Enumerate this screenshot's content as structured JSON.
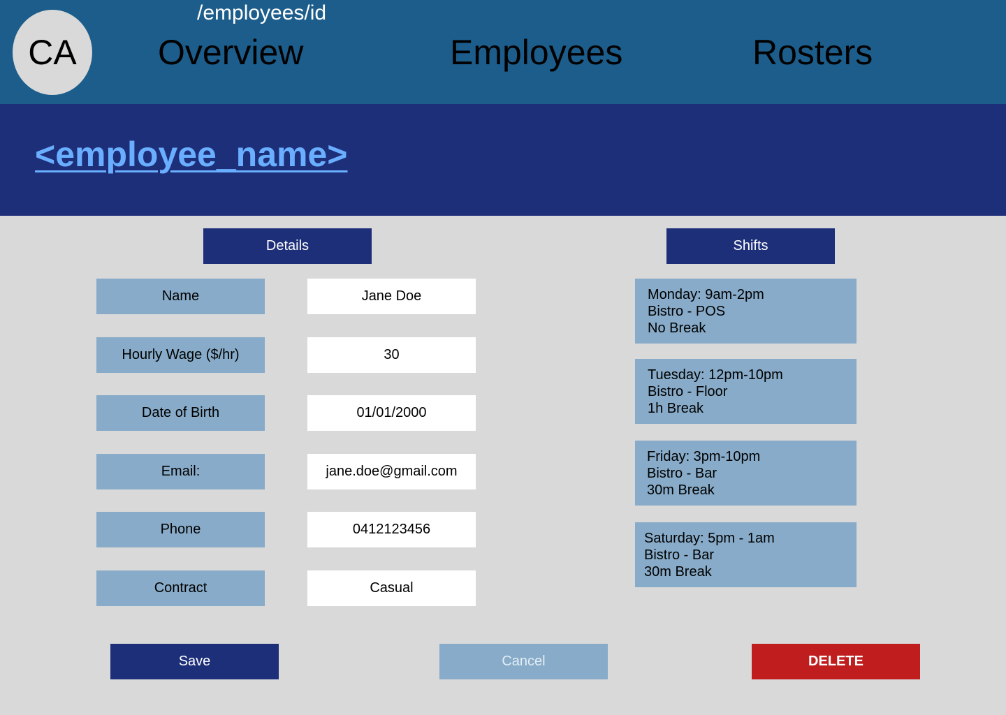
{
  "header": {
    "avatar": "CA",
    "route": "/employees/id",
    "nav": [
      "Overview",
      "Employees",
      "Rosters"
    ]
  },
  "page_title": "<employee_name>",
  "sections": {
    "details": "Details",
    "shifts": "Shifts"
  },
  "fields": [
    {
      "label": "Name",
      "value": "Jane Doe"
    },
    {
      "label": "Hourly Wage ($/hr)",
      "value": "30"
    },
    {
      "label": "Date of Birth",
      "value": "01/01/2000"
    },
    {
      "label": "Email:",
      "value": "jane.doe@gmail.com"
    },
    {
      "label": "Phone",
      "value": "0412123456"
    },
    {
      "label": "Contract",
      "value": "Casual"
    }
  ],
  "shifts": [
    {
      "time": "Monday: 9am-2pm",
      "location": "Bistro - POS",
      "break": "No Break"
    },
    {
      "time": "Tuesday: 12pm-10pm",
      "location": "Bistro - Floor",
      "break": "1h Break"
    },
    {
      "time": "Friday: 3pm-10pm",
      "location": "Bistro - Bar",
      "break": "30m Break"
    },
    {
      "time": "Saturday: 5pm - 1am",
      "location": "Bistro - Bar",
      "break": "30m Break"
    }
  ],
  "buttons": {
    "save": "Save",
    "cancel": "Cancel",
    "delete": "DELETE"
  },
  "colors": {
    "topbar": "#1c5d8b",
    "band": "#1e2f79",
    "accent_light": "#87abc8",
    "title": "#6aaeff",
    "delete": "#c01e1e"
  }
}
